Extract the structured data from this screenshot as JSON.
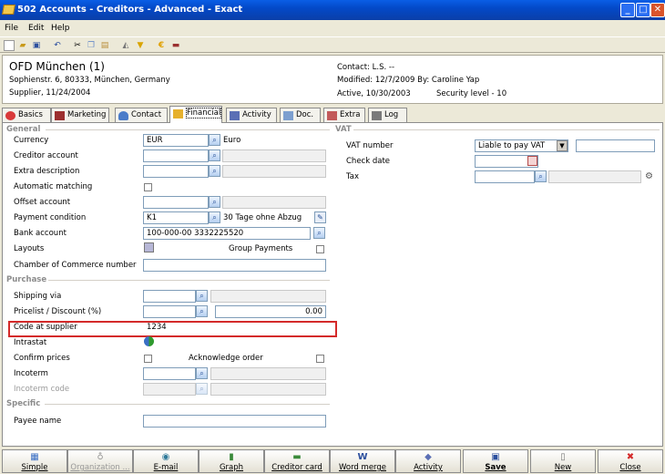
{
  "window": {
    "title": "502 Accounts - Creditors - Advanced - Exact",
    "minimize": "_",
    "maximize": "□",
    "close": "✕"
  },
  "menu": [
    "File",
    "Edit",
    "Help"
  ],
  "header": {
    "name": "OFD München (1)",
    "address": "Sophienstr. 6, 80333, München, Germany",
    "since": "Supplier, 11/24/2004",
    "contact": "Contact: L.S. --",
    "modified": "Modified: 12/7/2009  By: Caroline Yap",
    "active": "Active, 10/30/2003",
    "security": "Security level - 10"
  },
  "tabs": [
    "Basics",
    "Marketing",
    "Contact",
    "Financial",
    "Activity",
    "Doc.",
    "Extra",
    "Log"
  ],
  "general": {
    "section": "General",
    "currency_label": "Currency",
    "currency_value": "EUR",
    "currency_desc": "Euro",
    "creditor_account_label": "Creditor account",
    "extra_desc_label": "Extra description",
    "auto_matching_label": "Automatic matching",
    "offset_account_label": "Offset account",
    "payment_condition_label": "Payment condition",
    "payment_condition_value": "K1",
    "payment_condition_desc": "30 Tage ohne Abzug",
    "bank_account_label": "Bank account",
    "bank_account_value": "100-000-00 3332225520",
    "layouts_label": "Layouts",
    "group_payments_label": "Group Payments",
    "coc_label": "Chamber of Commerce number"
  },
  "purchase": {
    "section": "Purchase",
    "shipping_label": "Shipping via",
    "pricelist_label": "Pricelist / Discount (%)",
    "discount_value": "0.00",
    "code_label": "Code at supplier",
    "code_value": "1234",
    "intrastat_label": "Intrastat",
    "confirm_prices_label": "Confirm prices",
    "ack_order_label": "Acknowledge order",
    "incoterm_label": "Incoterm",
    "incoterm_code_label": "Incoterm code"
  },
  "specific": {
    "section": "Specific",
    "payee_label": "Payee name"
  },
  "vat": {
    "section": "VAT",
    "vat_number_label": "VAT number",
    "vat_select": "Liable to pay VAT",
    "check_date_label": "Check date",
    "tax_label": "Tax"
  },
  "footer": [
    "Simple",
    "Organization ...",
    "E-mail",
    "Graph",
    "Creditor card",
    "Word merge",
    "Activity",
    "Save",
    "New",
    "Close"
  ]
}
